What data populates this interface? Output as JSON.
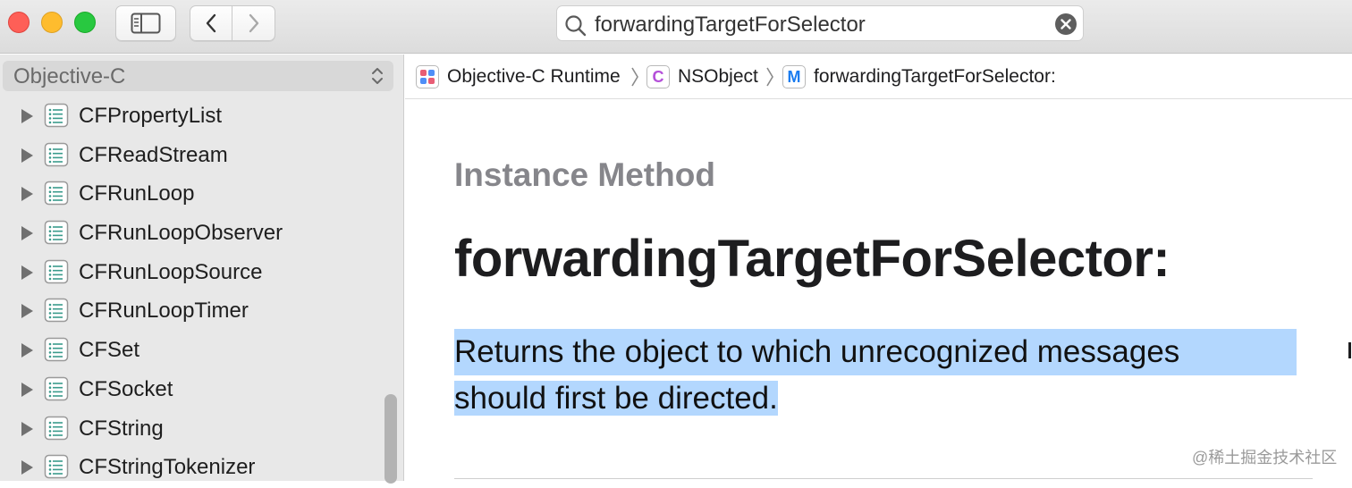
{
  "toolbar": {
    "search": {
      "value": "forwardingTargetForSelector"
    }
  },
  "sidebar": {
    "language": "Objective-C",
    "items": [
      {
        "label": "CFPropertyList"
      },
      {
        "label": "CFReadStream"
      },
      {
        "label": "CFRunLoop"
      },
      {
        "label": "CFRunLoopObserver"
      },
      {
        "label": "CFRunLoopSource"
      },
      {
        "label": "CFRunLoopTimer"
      },
      {
        "label": "CFSet"
      },
      {
        "label": "CFSocket"
      },
      {
        "label": "CFString"
      },
      {
        "label": "CFStringTokenizer"
      }
    ]
  },
  "breadcrumb": [
    {
      "badge": "",
      "label": "Objective-C Runtime"
    },
    {
      "badge": "C",
      "label": "NSObject"
    },
    {
      "badge": "M",
      "label": "forwardingTargetForSelector:"
    }
  ],
  "content": {
    "eyebrow": "Instance Method",
    "title": "forwardingTargetForSelector:",
    "abstract_line1": "Returns the object to which unrecognized messages",
    "abstract_line2": "should first be directed."
  },
  "watermark": "@稀土掘金技术社区",
  "colors": {
    "selection": "#b3d7fe",
    "class_badge": "#b44fd9",
    "method_badge": "#1a7cf0",
    "doc_icon": "#3a9b8c"
  }
}
